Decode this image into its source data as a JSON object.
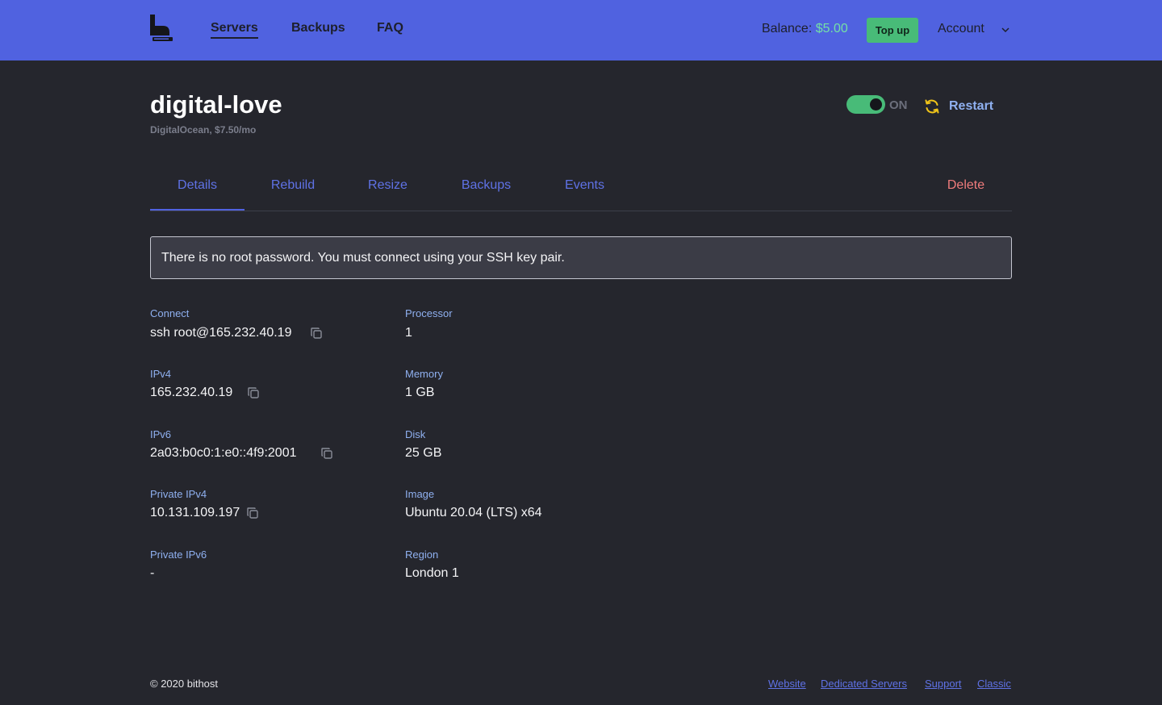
{
  "header": {
    "nav": [
      {
        "label": "Servers",
        "active": true
      },
      {
        "label": "Backups"
      },
      {
        "label": "FAQ"
      }
    ],
    "balance_label": "Balance:",
    "balance_amount": "$5.00",
    "topup_label": "Top up",
    "account_label": "Account"
  },
  "server": {
    "name": "digital-love",
    "subtitle": "DigitalOcean, $7.50/mo",
    "power_state": "ON",
    "restart_label": "Restart"
  },
  "tabs": [
    {
      "label": "Details",
      "active": true
    },
    {
      "label": "Rebuild"
    },
    {
      "label": "Resize"
    },
    {
      "label": "Backups"
    },
    {
      "label": "Events"
    },
    {
      "label": "Delete"
    }
  ],
  "notice": "There is no root password. You must connect using your SSH key pair.",
  "details_left": [
    {
      "label": "Connect",
      "value": "ssh root@165.232.40.19",
      "copyable": true
    },
    {
      "label": "IPv4",
      "value": "165.232.40.19",
      "copyable": true
    },
    {
      "label": "IPv6",
      "value": "2a03:b0c0:1:e0::4f9:2001",
      "copyable": true
    },
    {
      "label": "Private IPv4",
      "value": "10.131.109.197",
      "copyable": true
    },
    {
      "label": "Private IPv6",
      "value": "-",
      "copyable": false
    }
  ],
  "details_right": [
    {
      "label": "Processor",
      "value": "1"
    },
    {
      "label": "Memory",
      "value": "1 GB"
    },
    {
      "label": "Disk",
      "value": "25 GB"
    },
    {
      "label": "Image",
      "value": "Ubuntu 20.04 (LTS) x64"
    },
    {
      "label": "Region",
      "value": "London 1"
    }
  ],
  "footer": {
    "copyright": "© 2020 bithost",
    "links": [
      "Website",
      "Dedicated Servers",
      "Support",
      "Classic"
    ]
  },
  "colors": {
    "topbar": "#5062e0",
    "background": "#25262d",
    "accent_green": "#48bb78",
    "tab_blue": "#5f72e6",
    "label_blue": "#8fb0f0",
    "danger": "#f07c7c"
  },
  "icons": {
    "logo": "bithost-logo",
    "copy": "copy-icon",
    "restart": "refresh-icon",
    "account_chevron": "chevron-down-icon"
  }
}
